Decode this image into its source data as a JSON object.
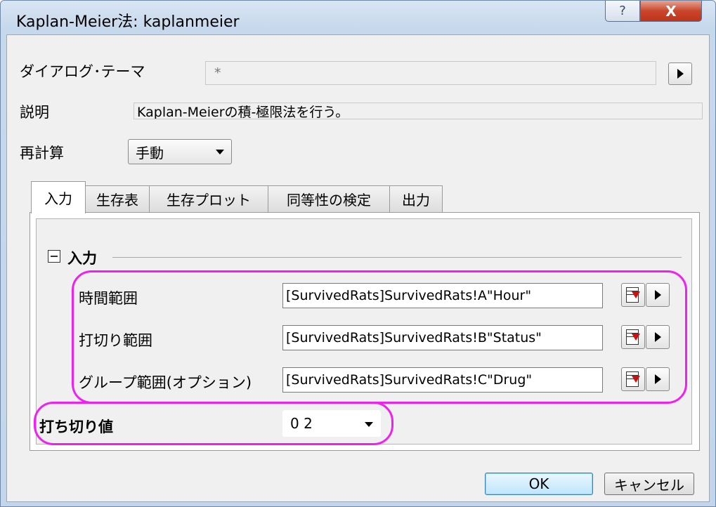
{
  "window": {
    "title": "Kaplan-Meier法: kaplanmeier",
    "help_glyph": "?",
    "close_glyph": "X"
  },
  "theme": {
    "label": "ダイアログ･テーマ",
    "value": "*"
  },
  "description": {
    "label": "説明",
    "value": "Kaplan-Meierの積-極限法を行う。"
  },
  "recalc": {
    "label": "再計算",
    "value": "手動"
  },
  "tabs": [
    {
      "label": "入力",
      "active": true
    },
    {
      "label": "生存表",
      "active": false
    },
    {
      "label": "生存プロット",
      "active": false
    },
    {
      "label": "同等性の検定",
      "active": false
    },
    {
      "label": "出力",
      "active": false
    }
  ],
  "input_section": {
    "heading": "入力",
    "rows": [
      {
        "label": "時間範囲",
        "value": "[SurvivedRats]SurvivedRats!A\"Hour\""
      },
      {
        "label": "打切り範囲",
        "value": "[SurvivedRats]SurvivedRats!B\"Status\""
      },
      {
        "label": "グループ範囲(オプション)",
        "value": "[SurvivedRats]SurvivedRats!C\"Drug\""
      }
    ],
    "censor": {
      "label": "打ち切り値",
      "value": "0 2"
    }
  },
  "buttons": {
    "ok": "OK",
    "cancel": "キャンセル"
  },
  "colors": {
    "highlight": "#ee22ee",
    "close_red": "#c9462c"
  }
}
